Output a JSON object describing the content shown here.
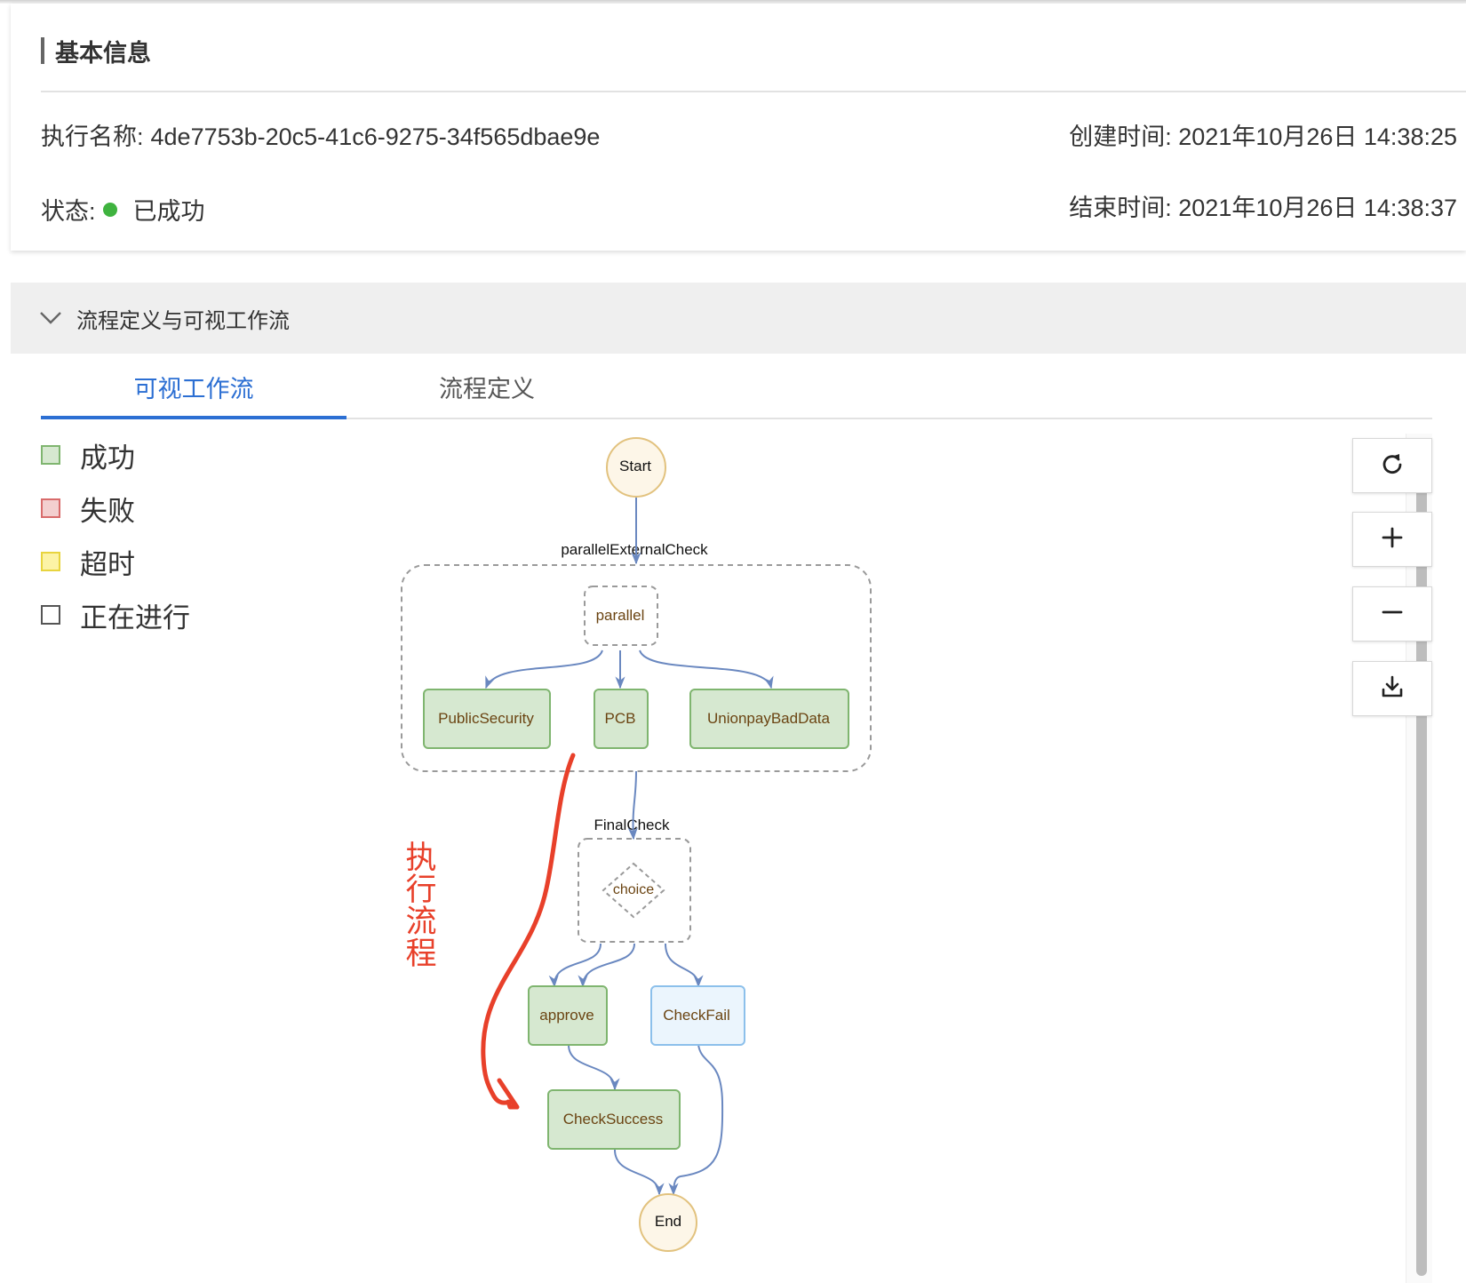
{
  "basic_info": {
    "title": "基本信息",
    "exec_name_label": "执行名称:",
    "exec_name": "4de7753b-20c5-41c6-9275-34f565dbae9e",
    "status_label": "状态:",
    "status_value": "已成功",
    "status_color": "#3fb33f",
    "created_label": "创建时间:",
    "created_value": "2021年10月26日 14:38:25",
    "ended_label": "结束时间:",
    "ended_value": "2021年10月26日 14:38:37"
  },
  "panel": {
    "title": "流程定义与可视工作流",
    "icon": "chevron-down-icon"
  },
  "tabs": [
    {
      "label": "可视工作流",
      "active": true
    },
    {
      "label": "流程定义",
      "active": false
    }
  ],
  "legend": [
    {
      "label": "成功",
      "fill": "#d6e8d0",
      "stroke": "#7fb56f"
    },
    {
      "label": "失败",
      "fill": "#f3cfcf",
      "stroke": "#d86b6b"
    },
    {
      "label": "超时",
      "fill": "#fcf3a6",
      "stroke": "#e8d43f"
    },
    {
      "label": "正在进行",
      "fill": "#ffffff",
      "stroke": "#555555"
    }
  ],
  "workflow": {
    "start": "Start",
    "end": "End",
    "group_parallel": "parallelExternalCheck",
    "parallel_node": "parallel",
    "branch_public": "PublicSecurity",
    "branch_pcb": "PCB",
    "branch_unionpay": "UnionpayBadData",
    "group_final": "FinalCheck",
    "choice_node": "choice",
    "approve": "approve",
    "check_fail": "CheckFail",
    "check_success": "CheckSuccess",
    "colors": {
      "success_fill": "#d6e8d0",
      "success_stroke": "#7fb56f",
      "pending_fill": "#ebf5fd",
      "pending_stroke": "#8cc0eb",
      "terminal_fill": "#fdf6e8",
      "terminal_stroke": "#e2c27e",
      "edge": "#6a88c0",
      "node_text": "#6b4412"
    }
  },
  "controls": [
    {
      "name": "refresh-button",
      "icon": "refresh-icon"
    },
    {
      "name": "zoom-in-button",
      "icon": "plus-icon"
    },
    {
      "name": "zoom-out-button",
      "icon": "minus-icon"
    },
    {
      "name": "download-button",
      "icon": "download-icon"
    }
  ],
  "annotation": {
    "text": [
      "执",
      "行",
      "流",
      "程"
    ],
    "color": "#e8402a"
  }
}
